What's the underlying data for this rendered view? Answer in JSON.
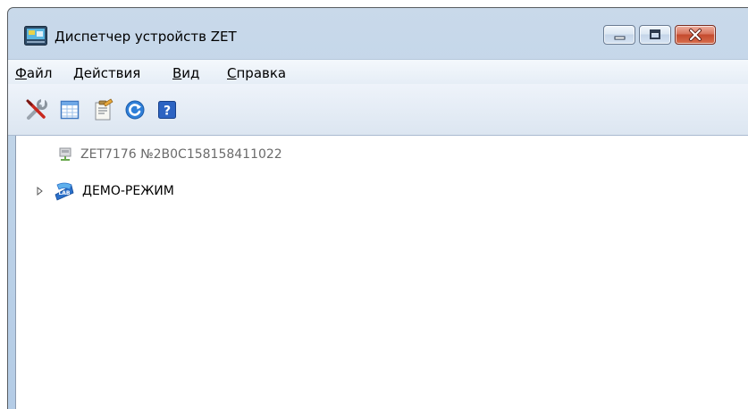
{
  "window": {
    "title": "Диспетчер устройств ZET",
    "buttons": {
      "minimize_icon": "minimize-icon",
      "maximize_icon": "maximize-icon",
      "close_icon": "close-icon"
    }
  },
  "menu": [
    {
      "label": "Файл",
      "accel": "Ф"
    },
    {
      "label": "Действия",
      "accel": "Д"
    },
    {
      "label": "Вид",
      "accel": "В"
    },
    {
      "label": "Справка",
      "accel": "С"
    }
  ],
  "toolbar": {
    "buttons": [
      {
        "icon": "tools-icon"
      },
      {
        "icon": "table-view-icon"
      },
      {
        "icon": "properties-icon"
      },
      {
        "icon": "refresh-icon"
      },
      {
        "icon": "help-icon"
      }
    ]
  },
  "tree": {
    "items": [
      {
        "label": "ZET7176 №2B0C158158411022",
        "icon": "network-device-icon",
        "expandable": false,
        "color": "#6b6b6b"
      },
      {
        "label": "ДЕМО-РЕЖИМ",
        "icon": "demo-mode-icon",
        "expandable": true,
        "color": "#000000"
      }
    ]
  },
  "colors": {
    "title_bar": "#bed3e8",
    "close_button": "#c44a2e",
    "accent_blue": "#2a6fc9"
  }
}
